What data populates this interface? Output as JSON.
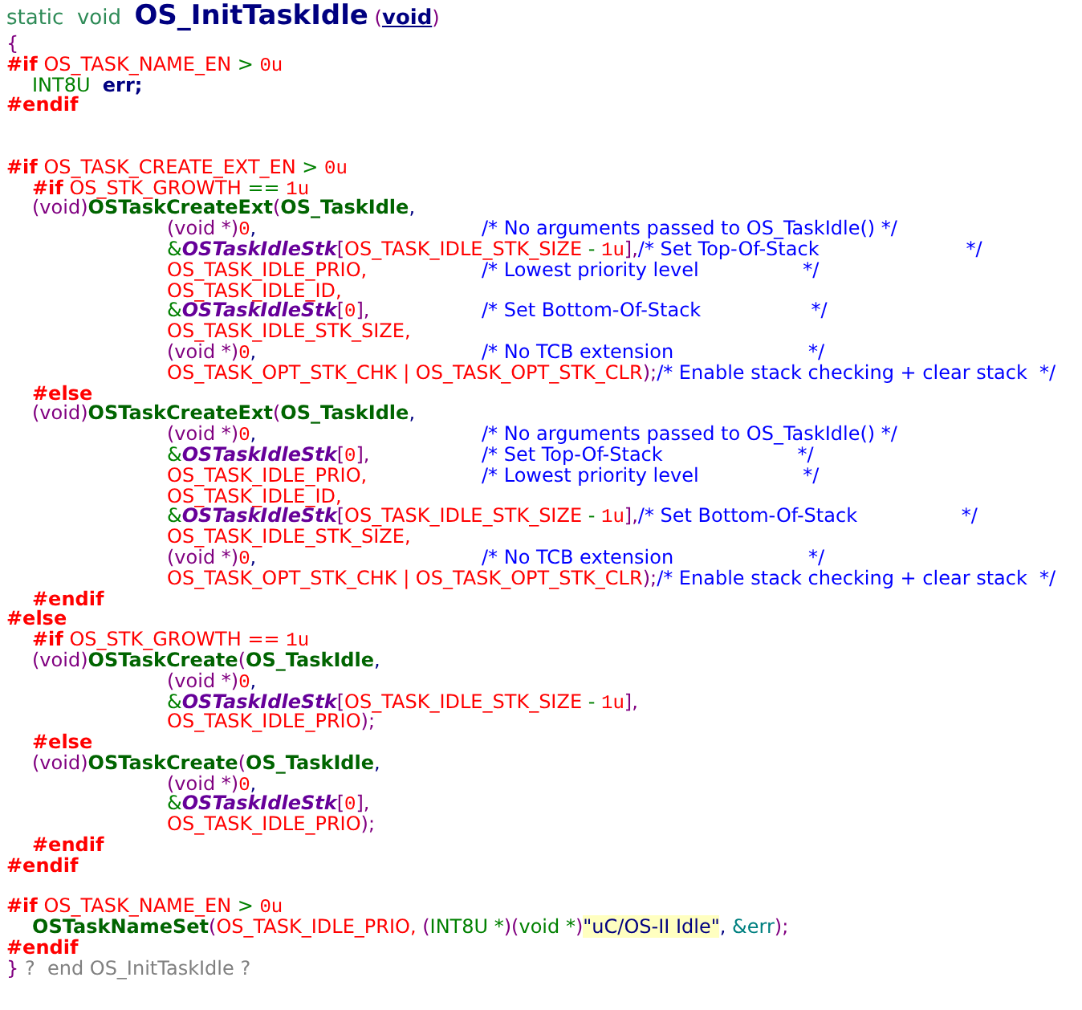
{
  "code_lines": [
    {
      "kind": "code",
      "tokens": [
        {
          "kind": "keyword",
          "text": "static  void  "
        },
        {
          "kind": "function_name",
          "text": "OS_InitTaskIdle"
        },
        {
          "kind": "punct",
          "text": " ("
        },
        {
          "kind": "param",
          "text": "void"
        },
        {
          "kind": "punct",
          "text": ")"
        }
      ]
    },
    {
      "kind": "code",
      "tokens": [
        {
          "kind": "punct",
          "text": "{"
        }
      ]
    },
    {
      "kind": "code",
      "tokens": [
        {
          "kind": "directive",
          "text": "#if"
        },
        {
          "kind": "macro",
          "text": " OS_TASK_NAME_EN"
        },
        {
          "kind": "operator",
          "text": " > "
        },
        {
          "kind": "number",
          "text": "0u"
        }
      ],
      "children": [
        {
          "kind": "code",
          "tokens": [
            {
              "kind": "type",
              "text": "INT8U  "
            },
            {
              "kind": "ident",
              "text": "err;"
            }
          ]
        }
      ]
    },
    {
      "kind": "code",
      "tokens": [
        {
          "kind": "directive",
          "text": "#endif"
        }
      ]
    },
    {
      "kind": "blank"
    },
    {
      "kind": "blank"
    },
    {
      "kind": "code",
      "tokens": [
        {
          "kind": "directive",
          "text": "#if"
        },
        {
          "kind": "macro",
          "text": " OS_TASK_CREATE_EXT_EN"
        },
        {
          "kind": "operator",
          "text": " > "
        },
        {
          "kind": "number",
          "text": "0u"
        }
      ],
      "children": [
        {
          "kind": "code",
          "tokens": [
            {
              "kind": "directive",
              "text": "#if"
            },
            {
              "kind": "macro",
              "text": " OS_STK_GROWTH"
            },
            {
              "kind": "operator",
              "text": " == "
            },
            {
              "kind": "number",
              "text": "1u"
            }
          ]
        },
        {
          "kind": "code",
          "tokens": [
            {
              "kind": "cast",
              "text": "(void)"
            },
            {
              "kind": "call",
              "text": "OSTaskCreateExt"
            },
            {
              "kind": "punct",
              "text": "("
            },
            {
              "kind": "arg",
              "text": "OS_TaskIdle"
            },
            {
              "kind": "plain",
              "text": ","
            }
          ],
          "children": [
            {
              "kind": "code",
              "tokens": [
                {
                  "kind": "cast",
                  "text": "(void *)"
                },
                {
                  "kind": "number",
                  "text": "0"
                },
                {
                  "kind": "plain",
                  "text": ","
                },
                {
                  "kind": "comment",
                  "text": "/* No arguments passed to OS_TaskIdle() */"
                }
              ]
            },
            {
              "kind": "code",
              "tokens": [
                {
                  "kind": "operator",
                  "text": "&"
                },
                {
                  "kind": "array",
                  "text": "OSTaskIdleStk"
                },
                {
                  "kind": "punct",
                  "text": "["
                },
                {
                  "kind": "macro",
                  "text": "OS_TASK_IDLE_STK_SIZE"
                },
                {
                  "kind": "operator",
                  "text": " - "
                },
                {
                  "kind": "number",
                  "text": "1u"
                },
                {
                  "kind": "punct",
                  "text": "],"
                },
                {
                  "kind": "comment",
                  "text": "/* Set Top-Of-Stack                        */"
                }
              ]
            },
            {
              "kind": "code",
              "tokens": [
                {
                  "kind": "macro",
                  "text": "OS_TASK_IDLE_PRIO,"
                },
                {
                  "kind": "comment",
                  "text": "/* Lowest priority level                 */"
                }
              ]
            },
            {
              "kind": "code",
              "tokens": [
                {
                  "kind": "macro",
                  "text": "OS_TASK_IDLE_ID,"
                }
              ]
            },
            {
              "kind": "code",
              "tokens": [
                {
                  "kind": "operator",
                  "text": "&"
                },
                {
                  "kind": "array",
                  "text": "OSTaskIdleStk"
                },
                {
                  "kind": "punct",
                  "text": "["
                },
                {
                  "kind": "number",
                  "text": "0"
                },
                {
                  "kind": "punct",
                  "text": "],"
                },
                {
                  "kind": "comment",
                  "text": "/* Set Bottom-Of-Stack                  */"
                }
              ]
            },
            {
              "kind": "code",
              "tokens": [
                {
                  "kind": "macro",
                  "text": "OS_TASK_IDLE_STK_SIZE,"
                }
              ]
            },
            {
              "kind": "code",
              "tokens": [
                {
                  "kind": "cast",
                  "text": "(void *)"
                },
                {
                  "kind": "number",
                  "text": "0"
                },
                {
                  "kind": "plain",
                  "text": ","
                },
                {
                  "kind": "comment",
                  "text": "/* No TCB extension                      */"
                }
              ]
            },
            {
              "kind": "code",
              "tokens": [
                {
                  "kind": "macro",
                  "text": "OS_TASK_OPT_STK_CHK | OS_TASK_OPT_STK_CLR"
                },
                {
                  "kind": "punct",
                  "text": ");"
                },
                {
                  "kind": "comment",
                  "text": "/* Enable stack checking + clear stack  */"
                }
              ]
            }
          ]
        },
        {
          "kind": "code",
          "tokens": [
            {
              "kind": "directive",
              "text": "#else"
            }
          ]
        },
        {
          "kind": "code",
          "tokens": [
            {
              "kind": "cast",
              "text": "(void)"
            },
            {
              "kind": "call",
              "text": "OSTaskCreateExt"
            },
            {
              "kind": "punct",
              "text": "("
            },
            {
              "kind": "arg",
              "text": "OS_TaskIdle"
            },
            {
              "kind": "plain",
              "text": ","
            }
          ],
          "children": [
            {
              "kind": "code",
              "tokens": [
                {
                  "kind": "cast",
                  "text": "(void *)"
                },
                {
                  "kind": "number",
                  "text": "0"
                },
                {
                  "kind": "plain",
                  "text": ","
                },
                {
                  "kind": "comment",
                  "text": "/* No arguments passed to OS_TaskIdle() */"
                }
              ]
            },
            {
              "kind": "code",
              "tokens": [
                {
                  "kind": "operator",
                  "text": "&"
                },
                {
                  "kind": "array",
                  "text": "OSTaskIdleStk"
                },
                {
                  "kind": "punct",
                  "text": "["
                },
                {
                  "kind": "number",
                  "text": "0"
                },
                {
                  "kind": "punct",
                  "text": "],"
                },
                {
                  "kind": "comment",
                  "text": "/* Set Top-Of-Stack                      */"
                }
              ]
            },
            {
              "kind": "code",
              "tokens": [
                {
                  "kind": "macro",
                  "text": "OS_TASK_IDLE_PRIO,"
                },
                {
                  "kind": "comment",
                  "text": "/* Lowest priority level                 */"
                }
              ]
            },
            {
              "kind": "code",
              "tokens": [
                {
                  "kind": "macro",
                  "text": "OS_TASK_IDLE_ID,"
                }
              ]
            },
            {
              "kind": "code",
              "tokens": [
                {
                  "kind": "operator",
                  "text": "&"
                },
                {
                  "kind": "array",
                  "text": "OSTaskIdleStk"
                },
                {
                  "kind": "punct",
                  "text": "["
                },
                {
                  "kind": "macro",
                  "text": "OS_TASK_IDLE_STK_SIZE"
                },
                {
                  "kind": "operator",
                  "text": " - "
                },
                {
                  "kind": "number",
                  "text": "1u"
                },
                {
                  "kind": "punct",
                  "text": "],"
                },
                {
                  "kind": "comment",
                  "text": "/* Set Bottom-Of-Stack                 */"
                }
              ]
            },
            {
              "kind": "code",
              "tokens": [
                {
                  "kind": "macro",
                  "text": "OS_TASK_IDLE_STK_SIZE,"
                }
              ]
            },
            {
              "kind": "code",
              "tokens": [
                {
                  "kind": "cast",
                  "text": "(void *)"
                },
                {
                  "kind": "number",
                  "text": "0"
                },
                {
                  "kind": "plain",
                  "text": ","
                },
                {
                  "kind": "comment",
                  "text": "/* No TCB extension                      */"
                }
              ]
            },
            {
              "kind": "code",
              "tokens": [
                {
                  "kind": "macro",
                  "text": "OS_TASK_OPT_STK_CHK | OS_TASK_OPT_STK_CLR"
                },
                {
                  "kind": "punct",
                  "text": ");"
                },
                {
                  "kind": "comment",
                  "text": "/* Enable stack checking + clear stack  */"
                }
              ]
            }
          ]
        },
        {
          "kind": "code",
          "tokens": [
            {
              "kind": "directive",
              "text": "#endif"
            }
          ]
        }
      ]
    },
    {
      "kind": "code",
      "tokens": [
        {
          "kind": "directive",
          "text": "#else"
        }
      ],
      "children": [
        {
          "kind": "code",
          "tokens": [
            {
              "kind": "directive",
              "text": "#if"
            },
            {
              "kind": "macro",
              "text": " OS_STK_GROWTH == "
            },
            {
              "kind": "number",
              "text": "1u"
            }
          ]
        },
        {
          "kind": "code",
          "tokens": [
            {
              "kind": "cast",
              "text": "(void)"
            },
            {
              "kind": "call",
              "text": "OSTaskCreate"
            },
            {
              "kind": "punct",
              "text": "("
            },
            {
              "kind": "arg",
              "text": "OS_TaskIdle"
            },
            {
              "kind": "plain",
              "text": ","
            }
          ],
          "children": [
            {
              "kind": "code",
              "tokens": [
                {
                  "kind": "cast",
                  "text": "(void *)"
                },
                {
                  "kind": "number",
                  "text": "0"
                },
                {
                  "kind": "plain",
                  "text": ","
                }
              ]
            },
            {
              "kind": "code",
              "tokens": [
                {
                  "kind": "operator",
                  "text": "&"
                },
                {
                  "kind": "array",
                  "text": "OSTaskIdleStk"
                },
                {
                  "kind": "punct",
                  "text": "["
                },
                {
                  "kind": "macro",
                  "text": "OS_TASK_IDLE_STK_SIZE"
                },
                {
                  "kind": "operator",
                  "text": " - "
                },
                {
                  "kind": "number",
                  "text": "1u"
                },
                {
                  "kind": "punct",
                  "text": "],"
                }
              ]
            },
            {
              "kind": "code",
              "tokens": [
                {
                  "kind": "macro",
                  "text": "OS_TASK_IDLE_PRIO"
                },
                {
                  "kind": "punct",
                  "text": ");"
                }
              ]
            }
          ]
        },
        {
          "kind": "code",
          "tokens": [
            {
              "kind": "directive",
              "text": "#else"
            }
          ]
        },
        {
          "kind": "code",
          "tokens": [
            {
              "kind": "cast",
              "text": "(void)"
            },
            {
              "kind": "call",
              "text": "OSTaskCreate"
            },
            {
              "kind": "punct",
              "text": "("
            },
            {
              "kind": "arg",
              "text": "OS_TaskIdle"
            },
            {
              "kind": "plain",
              "text": ","
            }
          ],
          "children": [
            {
              "kind": "code",
              "tokens": [
                {
                  "kind": "cast",
                  "text": "(void *)"
                },
                {
                  "kind": "number",
                  "text": "0"
                },
                {
                  "kind": "plain",
                  "text": ","
                }
              ]
            },
            {
              "kind": "code",
              "tokens": [
                {
                  "kind": "operator",
                  "text": "&"
                },
                {
                  "kind": "array",
                  "text": "OSTaskIdleStk"
                },
                {
                  "kind": "punct",
                  "text": "["
                },
                {
                  "kind": "number",
                  "text": "0"
                },
                {
                  "kind": "punct",
                  "text": "],"
                }
              ]
            },
            {
              "kind": "code",
              "tokens": [
                {
                  "kind": "macro",
                  "text": "OS_TASK_IDLE_PRIO"
                },
                {
                  "kind": "punct",
                  "text": ");"
                }
              ]
            }
          ]
        },
        {
          "kind": "code",
          "tokens": [
            {
              "kind": "directive",
              "text": "#endif"
            }
          ]
        }
      ]
    },
    {
      "kind": "code",
      "tokens": [
        {
          "kind": "directive",
          "text": "#endif"
        }
      ]
    },
    {
      "kind": "blank"
    },
    {
      "kind": "code",
      "tokens": [
        {
          "kind": "directive",
          "text": "#if"
        },
        {
          "kind": "macro",
          "text": " OS_TASK_NAME_EN"
        },
        {
          "kind": "operator",
          "text": " > "
        },
        {
          "kind": "number",
          "text": "0u"
        }
      ],
      "children": [
        {
          "kind": "code",
          "tokens": [
            {
              "kind": "call",
              "text": "OSTaskNameSet"
            },
            {
              "kind": "punct",
              "text": "("
            },
            {
              "kind": "macro",
              "text": "OS_TASK_IDLE_PRIO,"
            },
            {
              "kind": "punct",
              "text": " ("
            },
            {
              "kind": "type",
              "text": "INT8U *"
            },
            {
              "kind": "punct",
              "text": ")("
            },
            {
              "kind": "type",
              "text": "void *"
            },
            {
              "kind": "punct",
              "text": ")"
            },
            {
              "kind": "string",
              "text": "\"uC/OS-II Idle\""
            },
            {
              "kind": "plain",
              "text": ", "
            },
            {
              "kind": "ref",
              "text": "&err"
            },
            {
              "kind": "punct",
              "text": ");"
            }
          ]
        }
      ]
    },
    {
      "kind": "code",
      "tokens": [
        {
          "kind": "directive",
          "text": "#endif"
        }
      ]
    },
    {
      "kind": "code",
      "tokens": [
        {
          "kind": "punct",
          "text": "}"
        },
        {
          "kind": "note",
          "text": " ?  end OS_InitTaskIdle ?"
        }
      ]
    }
  ]
}
